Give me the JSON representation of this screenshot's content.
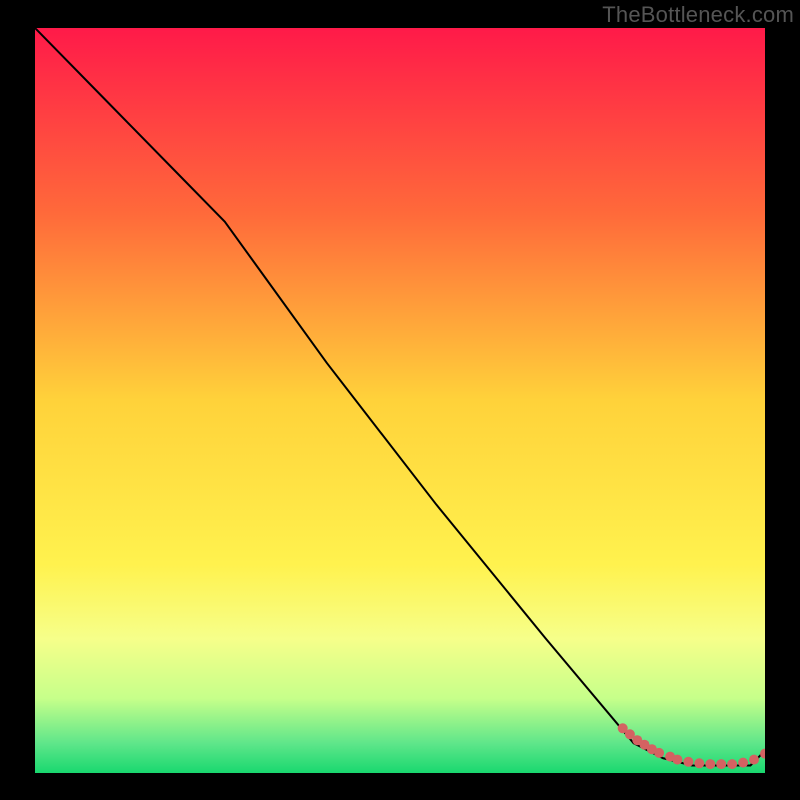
{
  "watermark": "TheBottleneck.com",
  "chart_data": {
    "type": "line",
    "title": "",
    "xlabel": "",
    "ylabel": "",
    "xlim": [
      0,
      100
    ],
    "ylim": [
      0,
      100
    ],
    "gradient_stops": [
      {
        "offset": 0,
        "color": "#ff1a49"
      },
      {
        "offset": 25,
        "color": "#ff6a3a"
      },
      {
        "offset": 50,
        "color": "#ffd23a"
      },
      {
        "offset": 72,
        "color": "#fff24e"
      },
      {
        "offset": 82,
        "color": "#f6ff8a"
      },
      {
        "offset": 90,
        "color": "#c6ff8a"
      },
      {
        "offset": 96,
        "color": "#5fe68a"
      },
      {
        "offset": 100,
        "color": "#19d86f"
      }
    ],
    "series": [
      {
        "name": "main-curve",
        "type": "line",
        "x": [
          0,
          10,
          20,
          26,
          40,
          55,
          70,
          82,
          86,
          90,
          94,
          98,
          100
        ],
        "y": [
          100,
          90,
          80,
          74,
          55,
          36,
          18,
          4,
          2,
          1,
          1,
          1,
          3
        ],
        "color": "#000000",
        "width": 2
      },
      {
        "name": "highlight-dots",
        "type": "scatter",
        "x": [
          80.5,
          81.5,
          82.5,
          83.5,
          84.5,
          85.5,
          87,
          88,
          89.5,
          91,
          92.5,
          94,
          95.5,
          97,
          98.5,
          100
        ],
        "y": [
          6.0,
          5.2,
          4.4,
          3.8,
          3.2,
          2.7,
          2.2,
          1.8,
          1.5,
          1.3,
          1.2,
          1.2,
          1.2,
          1.4,
          1.8,
          2.6
        ],
        "color": "#d46262",
        "radius": 5
      }
    ]
  }
}
